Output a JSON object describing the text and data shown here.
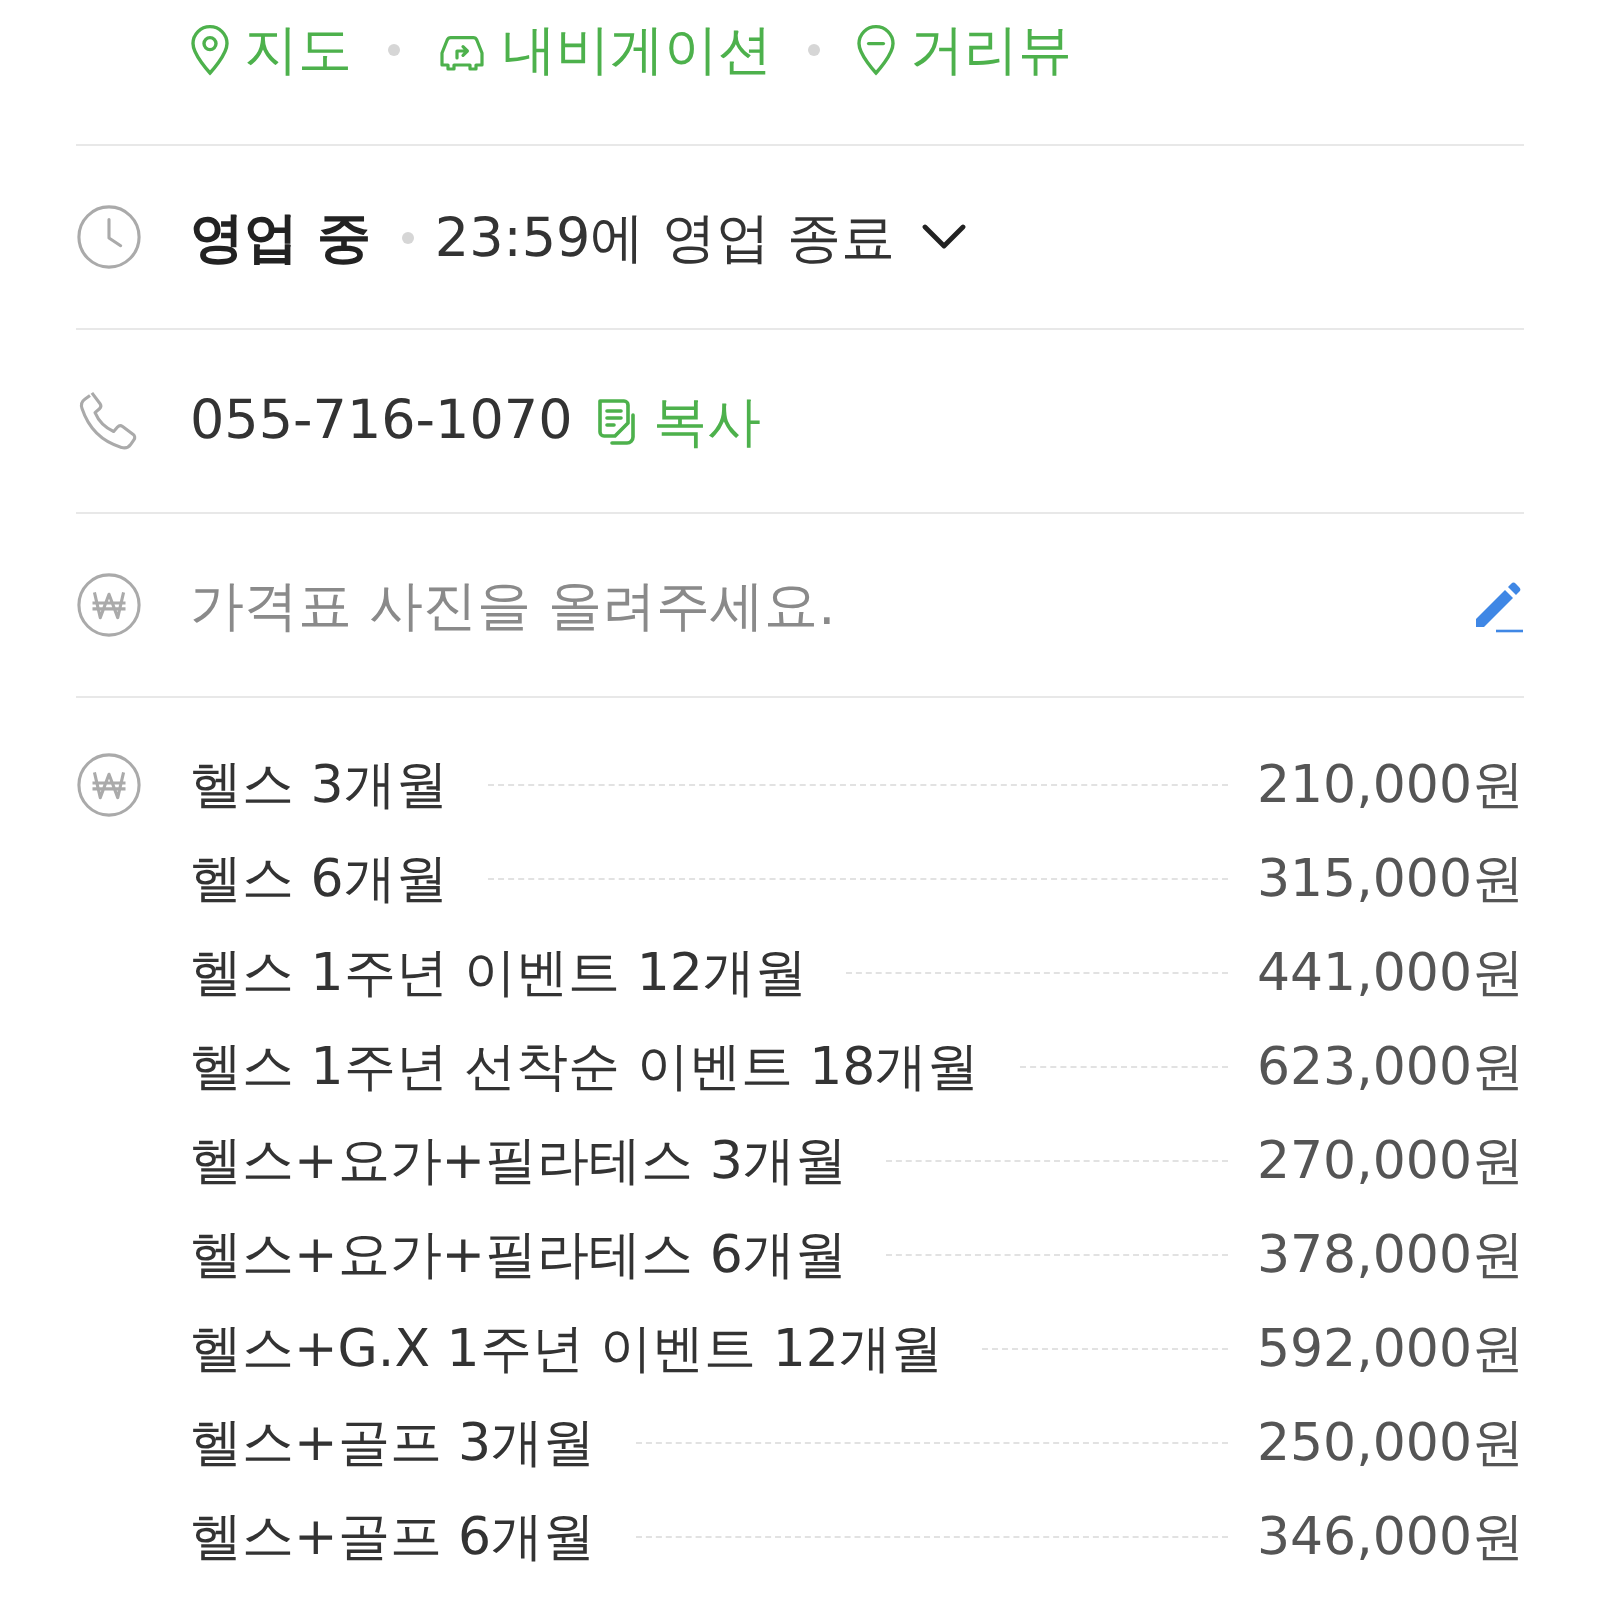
{
  "links": [
    {
      "kind": "map",
      "label": "지도"
    },
    {
      "kind": "navigation",
      "label": "내비게이션"
    },
    {
      "kind": "streetview",
      "label": "거리뷰"
    }
  ],
  "hours": {
    "status": "영업 중",
    "detail": "23:59에 영업 종료",
    "expanded": false
  },
  "phone": {
    "number": "055-716-1070",
    "copy_label": "복사"
  },
  "price_photo": {
    "prompt": "가격표 사진을 올려주세요."
  },
  "prices": [
    {
      "item": "헬스 3개월",
      "price": "210,000원"
    },
    {
      "item": "헬스 6개월",
      "price": "315,000원"
    },
    {
      "item": "헬스 1주년 이벤트 12개월",
      "price": "441,000원"
    },
    {
      "item": "헬스 1주년 선착순 이벤트 18개월",
      "price": "623,000원"
    },
    {
      "item": "헬스+요가+필라테스 3개월",
      "price": "270,000원"
    },
    {
      "item": "헬스+요가+필라테스 6개월",
      "price": "378,000원"
    },
    {
      "item": "헬스+G.X 1주년 이벤트 12개월",
      "price": "592,000원"
    },
    {
      "item": "헬스+골프 3개월",
      "price": "250,000원"
    },
    {
      "item": "헬스+골프 6개월",
      "price": "346,000원"
    }
  ]
}
